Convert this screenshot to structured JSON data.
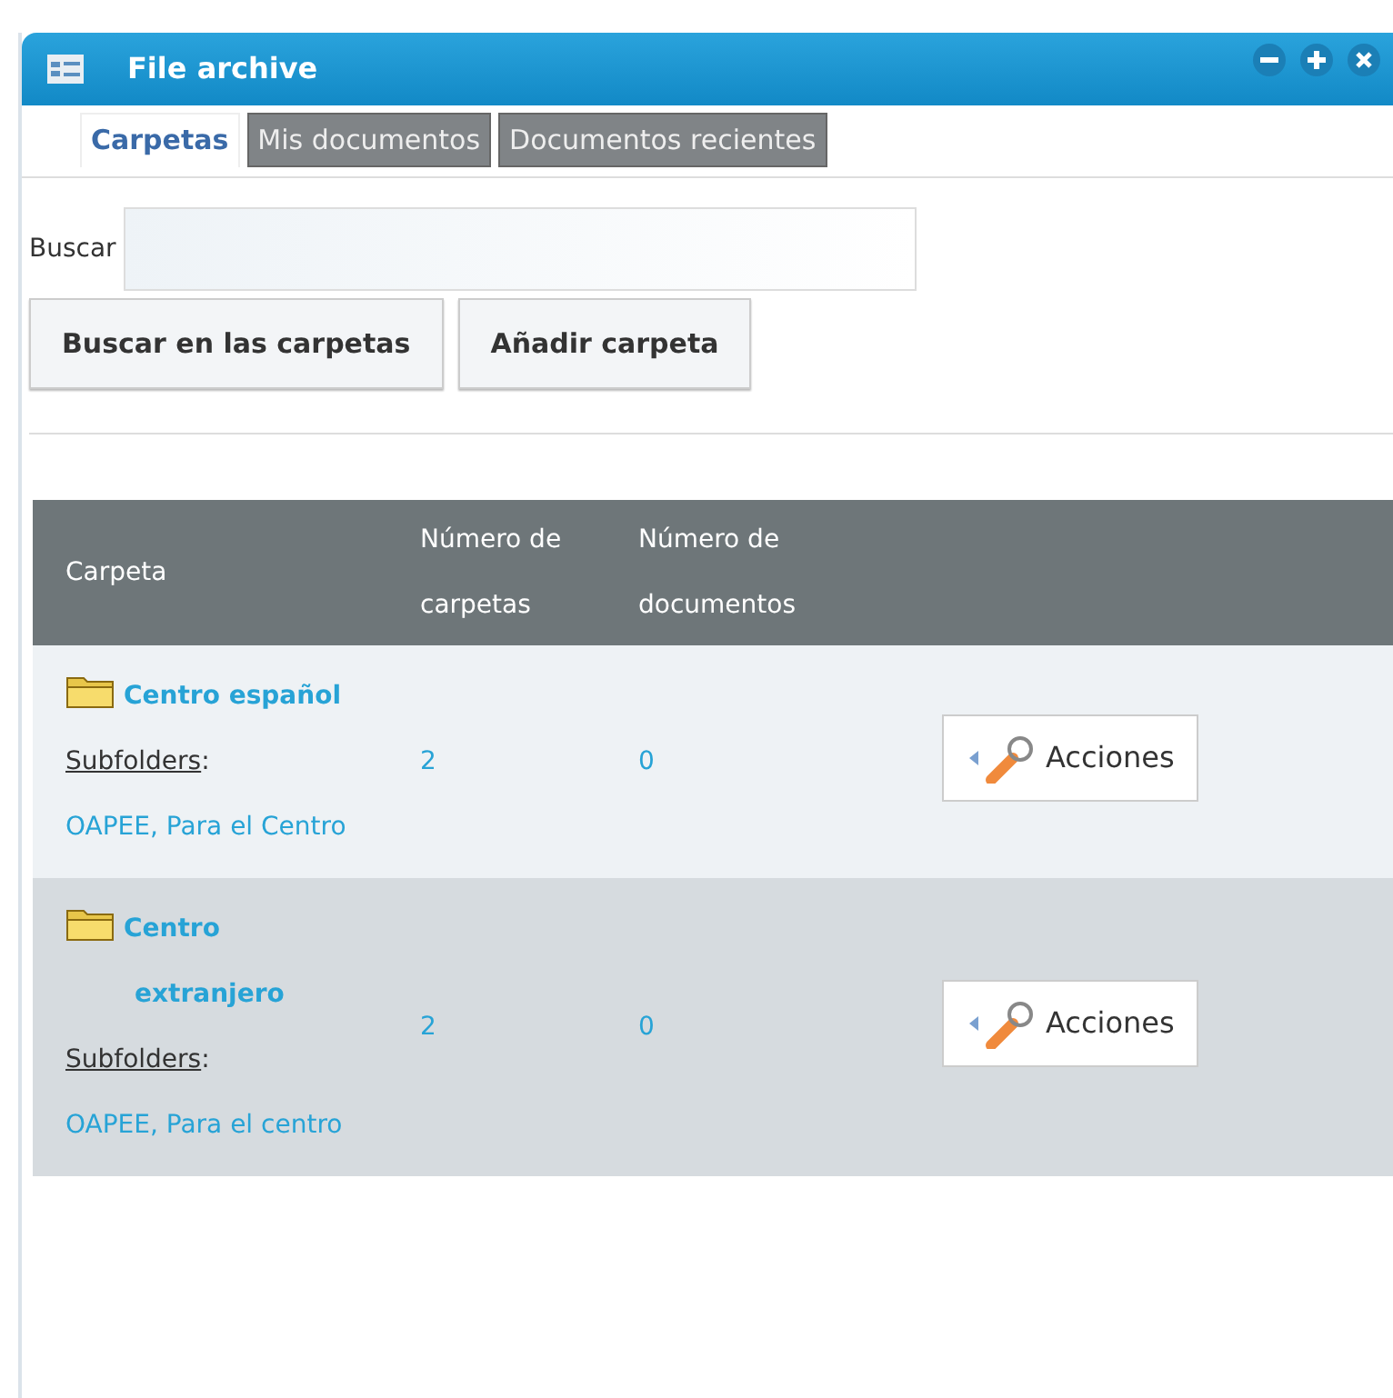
{
  "window": {
    "title": "File archive"
  },
  "tabs": [
    {
      "label": "Carpetas",
      "selected": true
    },
    {
      "label": "Mis documentos",
      "selected": false
    },
    {
      "label": "Documentos recientes",
      "selected": false
    }
  ],
  "search": {
    "label": "Buscar"
  },
  "buttons": [
    "Buscar en las carpetas",
    "Añadir carpeta"
  ],
  "table": {
    "columns": [
      "Carpeta",
      "Número de carpetas",
      "Número de documentos"
    ],
    "rows": [
      {
        "folder": "Centro español",
        "subfolders_label": "Subfolders",
        "label_suffix": ":",
        "subfolders_text": "OAPEE, Para el Centro",
        "folders": "2",
        "documents": "0",
        "action": "Acciones"
      },
      {
        "folder": "Centro extranjero",
        "subfolders_label": "Subfolders",
        "label_suffix": ":",
        "subfolders_text": "OAPEE, Para el centro",
        "folders": "2",
        "documents": "0",
        "action": "Acciones"
      }
    ]
  }
}
